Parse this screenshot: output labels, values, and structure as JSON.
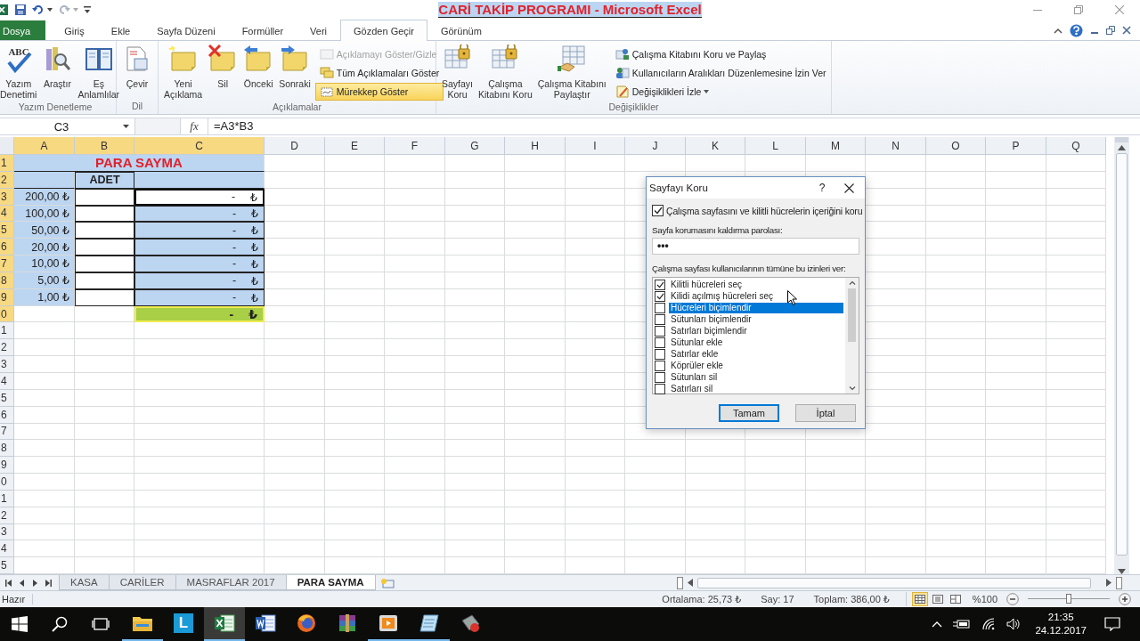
{
  "window": {
    "title": "CARİ TAKİP PROGRAMI  -  Microsoft Excel"
  },
  "tabs": [
    {
      "label": "Dosya",
      "kind": "file",
      "selected": false
    },
    {
      "label": "Giriş",
      "kind": "tab",
      "selected": false
    },
    {
      "label": "Ekle",
      "kind": "tab",
      "selected": false
    },
    {
      "label": "Sayfa Düzeni",
      "kind": "tab",
      "selected": false
    },
    {
      "label": "Formüller",
      "kind": "tab",
      "selected": false
    },
    {
      "label": "Veri",
      "kind": "tab",
      "selected": false
    },
    {
      "label": "Gözden Geçir",
      "kind": "tab",
      "selected": true
    },
    {
      "label": "Görünüm",
      "kind": "tab",
      "selected": false
    }
  ],
  "ribbon": {
    "groups": [
      {
        "label": "Yazım Denetleme",
        "large": [
          {
            "lines": [
              "Yazım",
              "Denetimi"
            ],
            "icon_text": "ABC"
          },
          {
            "lines": [
              "Araştır"
            ]
          },
          {
            "lines": [
              "Eş",
              "Anlamlılar"
            ]
          }
        ]
      },
      {
        "label": "Dil",
        "large": [
          {
            "lines": [
              "Çevir"
            ]
          }
        ]
      },
      {
        "label": "Açıklamalar",
        "large": [
          {
            "lines": [
              "Yeni",
              "Açıklama"
            ]
          },
          {
            "lines": [
              "Sil"
            ]
          },
          {
            "lines": [
              "Önceki"
            ]
          },
          {
            "lines": [
              "Sonraki"
            ]
          }
        ],
        "small": [
          {
            "label": "Açıklamayı Göster/Gizle",
            "disabled": true,
            "on": false,
            "dropdown": false
          },
          {
            "label": "Tüm Açıklamaları Göster",
            "disabled": false,
            "on": false,
            "dropdown": false
          },
          {
            "label": "Mürekkep Göster",
            "disabled": false,
            "on": true,
            "dropdown": false
          }
        ]
      },
      {
        "label": "Değişiklikler",
        "large": [
          {
            "lines": [
              "Sayfayı",
              "Koru"
            ]
          },
          {
            "lines": [
              "Çalışma",
              "Kitabını Koru"
            ]
          },
          {
            "lines": [
              "Çalışma Kitabını",
              "Paylaştır"
            ]
          }
        ],
        "small": [
          {
            "label": "Çalışma Kitabını Koru ve Paylaş",
            "disabled": false,
            "on": false,
            "dropdown": false
          },
          {
            "label": "Kullanıcıların Aralıkları Düzenlemesine İzin Ver",
            "disabled": false,
            "on": false,
            "dropdown": false
          },
          {
            "label": "Değişiklikleri İzle",
            "disabled": false,
            "on": false,
            "dropdown": true
          }
        ]
      }
    ]
  },
  "formula_bar": {
    "name_box": "C3",
    "fx": "fx",
    "formula": "=A3*B3"
  },
  "sheet": {
    "columns": [
      {
        "label": "A",
        "selected": true
      },
      {
        "label": "B",
        "selected": true
      },
      {
        "label": "C",
        "selected": true
      },
      {
        "label": "D",
        "selected": false
      },
      {
        "label": "E",
        "selected": false
      },
      {
        "label": "F",
        "selected": false
      },
      {
        "label": "G",
        "selected": false
      },
      {
        "label": "H",
        "selected": false
      },
      {
        "label": "I",
        "selected": false
      },
      {
        "label": "J",
        "selected": false
      },
      {
        "label": "K",
        "selected": false
      },
      {
        "label": "L",
        "selected": false
      },
      {
        "label": "M",
        "selected": false
      },
      {
        "label": "N",
        "selected": false
      },
      {
        "label": "O",
        "selected": false
      },
      {
        "label": "P",
        "selected": false
      },
      {
        "label": "Q",
        "selected": false
      }
    ],
    "rows": [
      {
        "label": "1",
        "selected": true,
        "cells": [
          {
            "kind": "title",
            "text": "PARA SAYMA"
          }
        ]
      },
      {
        "label": "2",
        "selected": true,
        "cells": [
          {
            "kind": "fill"
          },
          {
            "kind": "header",
            "text": "ADET"
          },
          {
            "kind": "fill"
          }
        ]
      },
      {
        "label": "3",
        "selected": true,
        "cells": [
          {
            "kind": "amount",
            "text": "200,00 ₺"
          },
          {
            "kind": "input"
          },
          {
            "kind": "currency",
            "dash": "-",
            "symbol": "₺",
            "selected": true
          }
        ]
      },
      {
        "label": "4",
        "selected": true,
        "cells": [
          {
            "kind": "amount",
            "text": "100,00 ₺"
          },
          {
            "kind": "input"
          },
          {
            "kind": "currency",
            "dash": "-",
            "symbol": "₺",
            "selected": false
          }
        ]
      },
      {
        "label": "5",
        "selected": true,
        "cells": [
          {
            "kind": "amount",
            "text": "50,00 ₺"
          },
          {
            "kind": "input"
          },
          {
            "kind": "currency",
            "dash": "-",
            "symbol": "₺",
            "selected": false
          }
        ]
      },
      {
        "label": "6",
        "selected": true,
        "cells": [
          {
            "kind": "amount",
            "text": "20,00 ₺"
          },
          {
            "kind": "input"
          },
          {
            "kind": "currency",
            "dash": "-",
            "symbol": "₺",
            "selected": false
          }
        ]
      },
      {
        "label": "7",
        "selected": true,
        "cells": [
          {
            "kind": "amount",
            "text": "10,00 ₺"
          },
          {
            "kind": "input"
          },
          {
            "kind": "currency",
            "dash": "-",
            "symbol": "₺",
            "selected": false
          }
        ]
      },
      {
        "label": "8",
        "selected": true,
        "cells": [
          {
            "kind": "amount",
            "text": "5,00 ₺"
          },
          {
            "kind": "input"
          },
          {
            "kind": "currency",
            "dash": "-",
            "symbol": "₺",
            "selected": false
          }
        ]
      },
      {
        "label": "9",
        "selected": true,
        "cells": [
          {
            "kind": "amount",
            "text": "1,00 ₺"
          },
          {
            "kind": "input"
          },
          {
            "kind": "currency",
            "dash": "-",
            "symbol": "₺",
            "selected": false
          }
        ]
      },
      {
        "label": "0",
        "selected": true,
        "cells": [
          {
            "kind": "empty"
          },
          {
            "kind": "empty"
          },
          {
            "kind": "total",
            "dash": "-",
            "symbol": "₺"
          }
        ]
      },
      {
        "label": "1",
        "selected": false
      },
      {
        "label": "2",
        "selected": false
      },
      {
        "label": "3",
        "selected": false
      },
      {
        "label": "4",
        "selected": false
      },
      {
        "label": "5",
        "selected": false
      },
      {
        "label": "6",
        "selected": false
      },
      {
        "label": "7",
        "selected": false
      },
      {
        "label": "8",
        "selected": false
      },
      {
        "label": "9",
        "selected": false
      },
      {
        "label": "0",
        "selected": false
      },
      {
        "label": "1",
        "selected": false
      },
      {
        "label": "2",
        "selected": false
      },
      {
        "label": "3",
        "selected": false
      },
      {
        "label": "4",
        "selected": false
      },
      {
        "label": "5",
        "selected": false
      }
    ]
  },
  "dialog": {
    "title": "Sayfayı Koru",
    "help": "?",
    "protect": {
      "label": "Çalışma sayfasını ve kilitli hücrelerin içeriğini koru",
      "checked": true
    },
    "password_label": "Sayfa korumasını kaldırma parolası:",
    "password": "•••",
    "permissions_label": "Çalışma sayfası kullanıcılarının tümüne bu izinleri ver:",
    "permissions": [
      {
        "label": "Kilitli hücreleri seç",
        "checked": true,
        "selected": false
      },
      {
        "label": "Kilidi açılmış hücreleri seç",
        "checked": true,
        "selected": false
      },
      {
        "label": "Hücreleri biçimlendir",
        "checked": false,
        "selected": true
      },
      {
        "label": "Sütunları biçimlendir",
        "checked": false,
        "selected": false
      },
      {
        "label": "Satırları biçimlendir",
        "checked": false,
        "selected": false
      },
      {
        "label": "Sütunlar ekle",
        "checked": false,
        "selected": false
      },
      {
        "label": "Satırlar ekle",
        "checked": false,
        "selected": false
      },
      {
        "label": "Köprüler ekle",
        "checked": false,
        "selected": false
      },
      {
        "label": "Sütunları sil",
        "checked": false,
        "selected": false
      },
      {
        "label": "Satırları sil",
        "checked": false,
        "selected": false
      }
    ],
    "buttons": [
      {
        "label": "Tamam",
        "default": true
      },
      {
        "label": "İptal",
        "default": false
      }
    ]
  },
  "sheet_tabs": [
    {
      "label": "KASA",
      "selected": false
    },
    {
      "label": "CARİLER",
      "selected": false
    },
    {
      "label": "MASRAFLAR 2017",
      "selected": false
    },
    {
      "label": "PARA SAYMA",
      "selected": true
    }
  ],
  "status_bar": {
    "ready": "Hazır",
    "stats": [
      "Ortalama: 25,73 ₺",
      "Say: 17",
      "Toplam: 386,00 ₺"
    ],
    "views": [
      {
        "selected": true
      },
      {
        "selected": false
      },
      {
        "selected": false
      }
    ],
    "zoom": "%100",
    "zoom_slider": {
      "level": 0.5
    }
  },
  "taskbar": {
    "apps": [
      {
        "open": true,
        "active": false
      },
      {
        "open": false,
        "active": false,
        "letter": "L"
      },
      {
        "open": true,
        "active": true
      },
      {
        "open": false,
        "active": false
      },
      {
        "open": false,
        "active": false
      },
      {
        "open": false,
        "active": false
      },
      {
        "open": true,
        "active": false
      },
      {
        "open": true,
        "active": false
      },
      {
        "open": false,
        "active": false
      }
    ],
    "time": "21:35",
    "date": "24.12.2017"
  }
}
